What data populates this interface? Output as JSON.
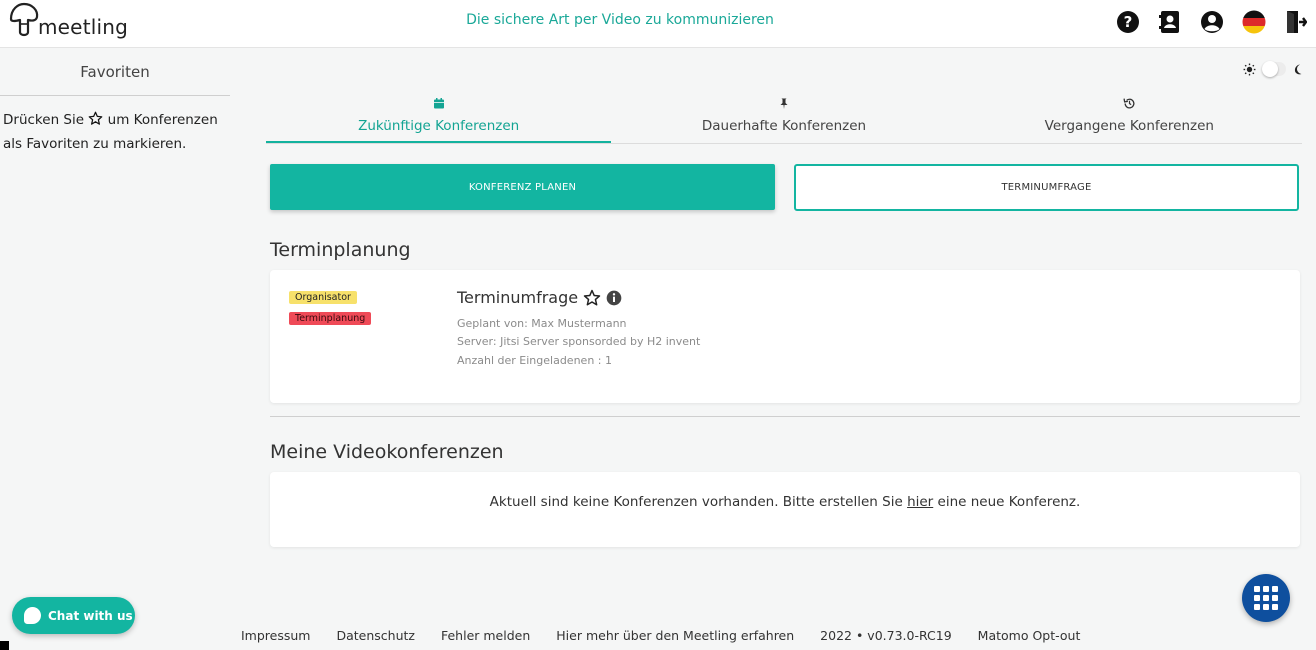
{
  "header": {
    "logo_text": "meetling",
    "tagline": "Die sichere Art per Video zu kommunizieren",
    "icons": [
      "help-icon",
      "contacts-icon",
      "account-icon",
      "german-flag-icon",
      "logout-icon"
    ]
  },
  "sidebar": {
    "title": "Favoriten",
    "hint_before": "Drücken Sie",
    "hint_after": "um Konferenzen als Favoriten zu markieren."
  },
  "tabs": [
    {
      "label": "Zukünftige Konferenzen",
      "icon": "calendar-icon",
      "active": true
    },
    {
      "label": "Dauerhafte Konferenzen",
      "icon": "pin-icon",
      "active": false
    },
    {
      "label": "Vergangene Konferenzen",
      "icon": "history-icon",
      "active": false
    }
  ],
  "actions": {
    "plan_label": "KONFERENZ PLANEN",
    "poll_label": "TERMINUMFRAGE"
  },
  "scheduling": {
    "title": "Terminplanung",
    "badge_organizer": "Organisator",
    "badge_planning": "Terminplanung",
    "conference_title": "Terminumfrage",
    "planned_by": "Geplant von: Max Mustermann",
    "server": "Server: Jitsi Server sponsorded by H2 invent",
    "invitees": "Anzahl der Eingeladenen : 1"
  },
  "video_conferences": {
    "title": "Meine Videokonferenzen",
    "empty_before": "Aktuell sind keine Konferenzen vorhanden. Bitte erstellen Sie",
    "empty_link": "hier",
    "empty_after": "eine neue Konferenz."
  },
  "chat": {
    "label": "Chat with us"
  },
  "footer": {
    "links": [
      "Impressum",
      "Datenschutz",
      "Fehler melden",
      "Hier mehr über den Meetling erfahren",
      "2022 • v0.73.0-RC19",
      "Matomo Opt-out"
    ]
  },
  "colors": {
    "accent": "#13b5a1",
    "fab": "#0e4f9e",
    "badge_yellow": "#f7e16b",
    "badge_red": "#ef4a57"
  }
}
